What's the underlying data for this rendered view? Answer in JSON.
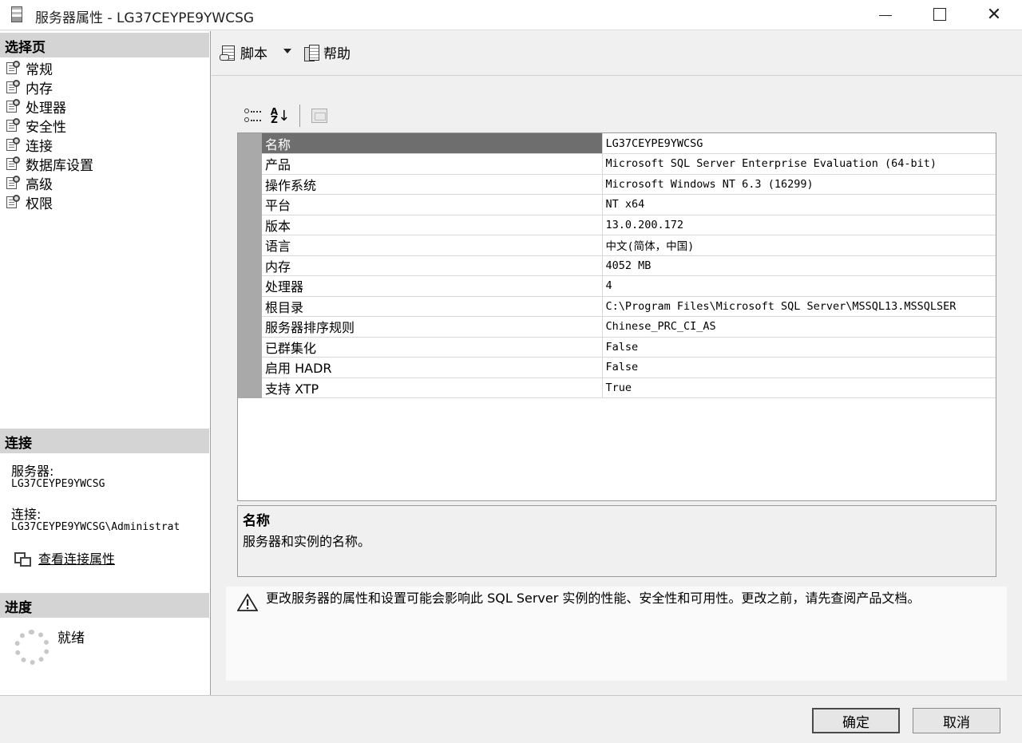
{
  "window": {
    "title": "服务器属性 - LG37CEYPE9YWCSG"
  },
  "left": {
    "pages_header": "选择页",
    "pages": [
      "常规",
      "内存",
      "处理器",
      "安全性",
      "连接",
      "数据库设置",
      "高级",
      "权限"
    ],
    "connection_header": "连接",
    "server_label": "服务器:",
    "server_value": "LG37CEYPE9YWCSG",
    "connection_label": "连接:",
    "connection_value": "LG37CEYPE9YWCSG\\Administrat",
    "view_conn_link": "查看连接属性",
    "progress_header": "进度",
    "progress_status": "就绪"
  },
  "toolbar": {
    "script_label": "脚本",
    "help_label": "帮助"
  },
  "grid": {
    "rows": [
      {
        "name": "名称",
        "value": "LG37CEYPE9YWCSG"
      },
      {
        "name": "产品",
        "value": "Microsoft SQL Server Enterprise Evaluation (64-bit)"
      },
      {
        "name": "操作系统",
        "value": "Microsoft Windows NT 6.3 (16299)"
      },
      {
        "name": "平台",
        "value": "NT x64"
      },
      {
        "name": "版本",
        "value": "13.0.200.172"
      },
      {
        "name": "语言",
        "value": "中文(简体，中国)"
      },
      {
        "name": "内存",
        "value": "4052 MB"
      },
      {
        "name": "处理器",
        "value": "4"
      },
      {
        "name": "根目录",
        "value": "C:\\Program Files\\Microsoft SQL Server\\MSSQL13.MSSQLSER"
      },
      {
        "name": "服务器排序规则",
        "value": "Chinese_PRC_CI_AS"
      },
      {
        "name": "已群集化",
        "value": "False"
      },
      {
        "name": "启用 HADR",
        "value": "False"
      },
      {
        "name": "支持 XTP",
        "value": "True"
      }
    ]
  },
  "description": {
    "title": "名称",
    "text": "服务器和实例的名称。"
  },
  "warning": {
    "text": "更改服务器的属性和设置可能会影响此 SQL Server 实例的性能、安全性和可用性。更改之前，请先查阅产品文档。"
  },
  "buttons": {
    "ok": "确定",
    "cancel": "取消"
  }
}
